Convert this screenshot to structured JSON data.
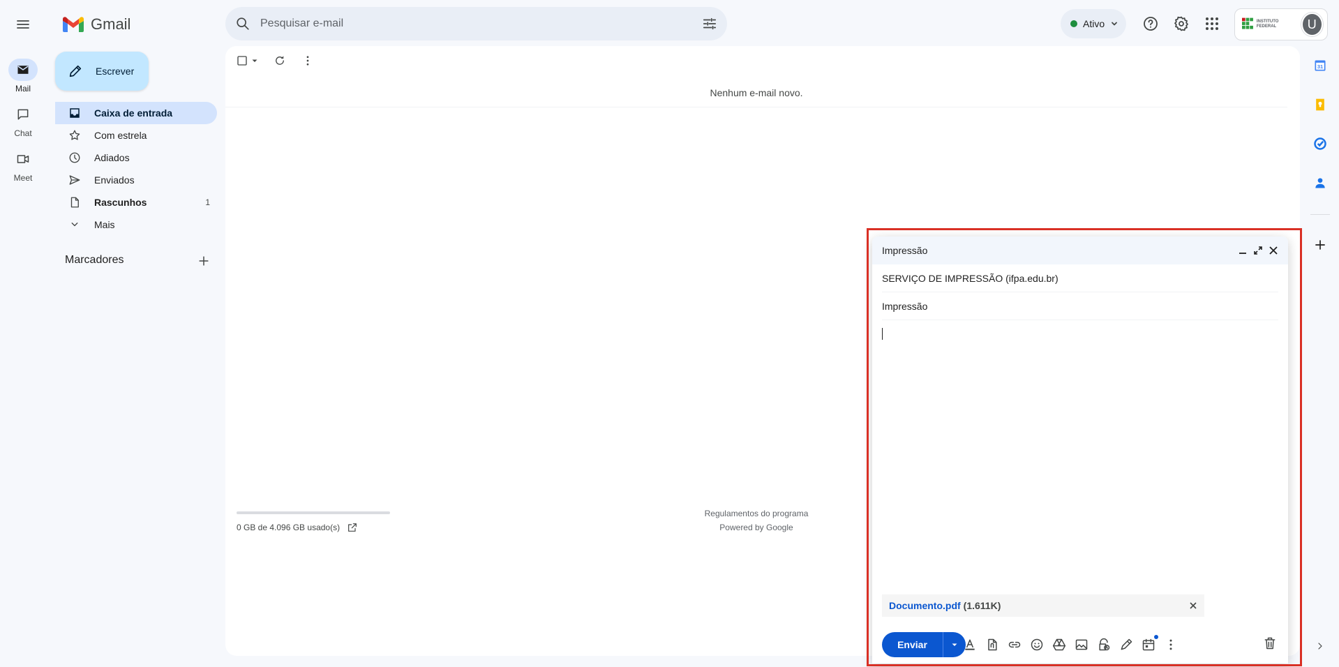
{
  "app": {
    "name": "Gmail"
  },
  "search": {
    "placeholder": "Pesquisar e-mail"
  },
  "status": {
    "label": "Ativo",
    "color": "#1e8e3e"
  },
  "account": {
    "org_name": "INSTITUTO FEDERAL",
    "avatar_letter": "U"
  },
  "rail": [
    {
      "label": "Mail",
      "icon": "mail-icon",
      "active": true
    },
    {
      "label": "Chat",
      "icon": "chat-icon",
      "active": false
    },
    {
      "label": "Meet",
      "icon": "meet-icon",
      "active": false
    }
  ],
  "compose_button": {
    "label": "Escrever"
  },
  "nav": [
    {
      "label": "Caixa de entrada",
      "icon": "inbox-icon",
      "active": true,
      "count": ""
    },
    {
      "label": "Com estrela",
      "icon": "star-icon",
      "active": false,
      "count": ""
    },
    {
      "label": "Adiados",
      "icon": "clock-icon",
      "active": false,
      "count": ""
    },
    {
      "label": "Enviados",
      "icon": "send-icon",
      "active": false,
      "count": ""
    },
    {
      "label": "Rascunhos",
      "icon": "draft-icon",
      "active": false,
      "count": "1",
      "bold": true
    },
    {
      "label": "Mais",
      "icon": "chevron-down-icon",
      "active": false,
      "count": ""
    }
  ],
  "labels": {
    "title": "Marcadores"
  },
  "main": {
    "empty_message": "Nenhum e-mail novo.",
    "storage_text": "0 GB de 4.096 GB usado(s)",
    "storage_used_fraction": 0,
    "footer_links": [
      "Regulamentos do programa",
      "Powered by Google"
    ]
  },
  "compose": {
    "title": "Impressão",
    "to": "SERVIÇO DE IMPRESSÃO (ifpa.edu.br)",
    "subject": "Impressão",
    "attachment": {
      "name": "Documento.pdf",
      "size": "(1.611K)"
    },
    "send_label": "Enviar"
  },
  "colors": {
    "accent": "#0b57d0",
    "compose_button": "#c2e7ff",
    "active_nav": "#d3e3fd",
    "highlight_border": "#d93025"
  }
}
